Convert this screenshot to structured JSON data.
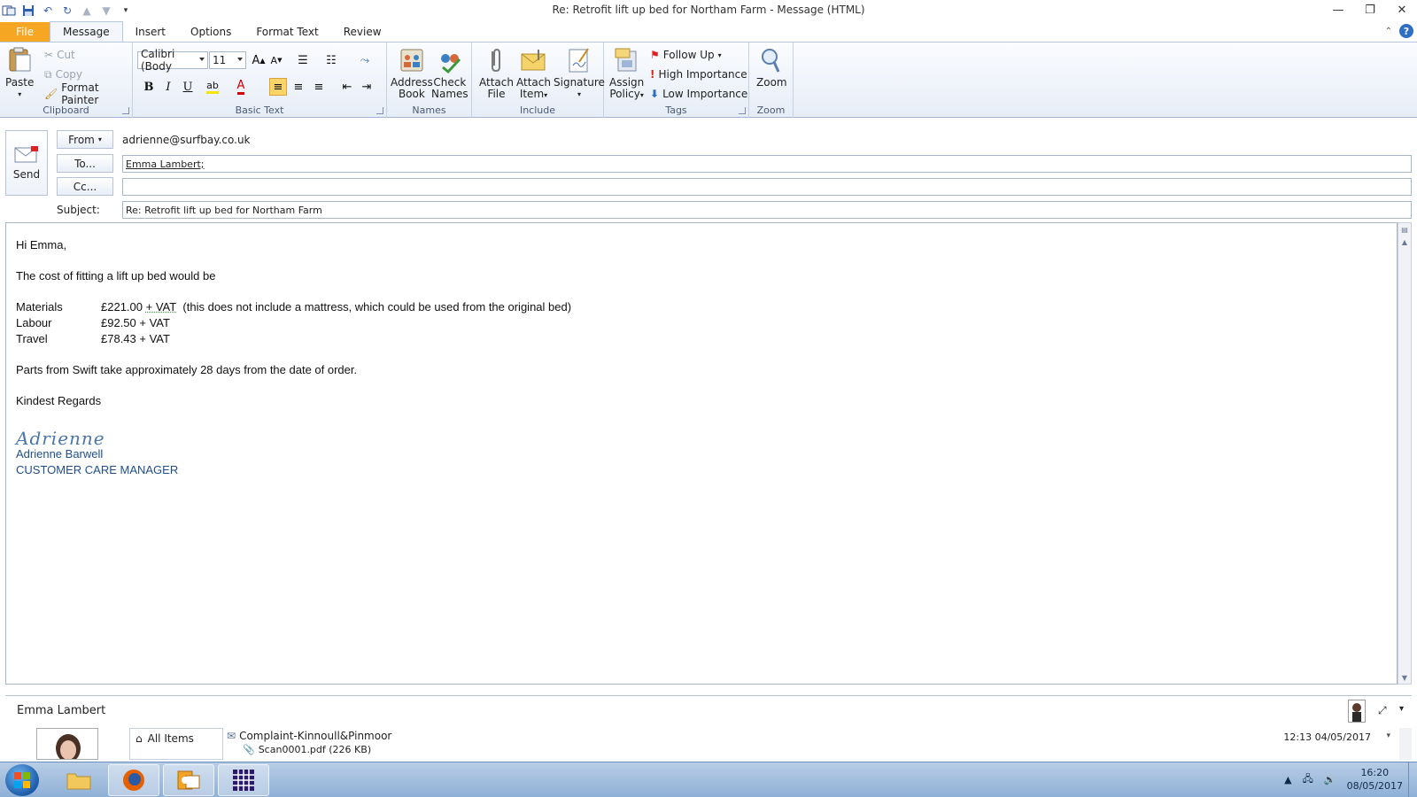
{
  "window": {
    "title": "Re: Retrofit lift up bed for Northam Farm  -  Message (HTML)"
  },
  "tabs": [
    "File",
    "Message",
    "Insert",
    "Options",
    "Format Text",
    "Review"
  ],
  "ribbon": {
    "clipboard": {
      "label": "Clipboard",
      "paste": "Paste",
      "cut": "Cut",
      "copy": "Copy",
      "format_painter": "Format Painter"
    },
    "basic_text": {
      "label": "Basic Text",
      "font": "Calibri (Body",
      "size": "11",
      "bold": "B",
      "italic": "I",
      "underline": "U"
    },
    "names": {
      "label": "Names",
      "address_book_1": "Address",
      "address_book_2": "Book",
      "check_names_1": "Check",
      "check_names_2": "Names"
    },
    "include": {
      "label": "Include",
      "attach_file_1": "Attach",
      "attach_file_2": "File",
      "attach_item_1": "Attach",
      "attach_item_2": "Item",
      "signature": "Signature"
    },
    "tags": {
      "label": "Tags",
      "assign_policy_1": "Assign",
      "assign_policy_2": "Policy",
      "follow_up": "Follow Up",
      "high_importance": "High Importance",
      "low_importance": "Low Importance"
    },
    "zoom": {
      "label": "Zoom",
      "zoom": "Zoom"
    }
  },
  "header": {
    "send": "Send",
    "from_label": "From",
    "from_value": "adrienne@surfbay.co.uk",
    "to_label": "To...",
    "to_value": "Emma Lambert;",
    "cc_label": "Cc...",
    "cc_value": "",
    "subject_label": "Subject:",
    "subject_value": "Re: Retrofit lift up bed for Northam Farm"
  },
  "body": {
    "greeting": "Hi Emma,",
    "intro": "The cost of fitting a lift up bed would be",
    "costs": [
      {
        "item": "Materials",
        "amount": "£221.00",
        "vat": "+ VAT",
        "note": "(this does not include a mattress, which could be used from the original bed)"
      },
      {
        "item": "Labour",
        "amount": "£92.50 + VAT",
        "vat": "",
        "note": ""
      },
      {
        "item": "Travel",
        "amount": "£78.43 + VAT",
        "vat": "",
        "note": ""
      }
    ],
    "parts_note": "Parts from Swift take approximately 28 days from the date of order.",
    "closing": "Kindest Regards",
    "signature_script": "Adrienne",
    "signature_name": "Adrienne Barwell",
    "signature_title": "CUSTOMER CARE MANAGER"
  },
  "people_pane": {
    "contact_name": "Emma Lambert",
    "all_items": "All Items",
    "item_subject": "Complaint-Kinnoull&Pinmoor",
    "item_attachment": "Scan0001.pdf (226 KB)",
    "item_time": "12:13  04/05/2017"
  },
  "taskbar": {
    "time": "16:20",
    "date": "08/05/2017"
  },
  "colors": {
    "file_tab": "#f5a623",
    "signature": "#1f4e8c",
    "taskbar": "#8fb0d6"
  }
}
